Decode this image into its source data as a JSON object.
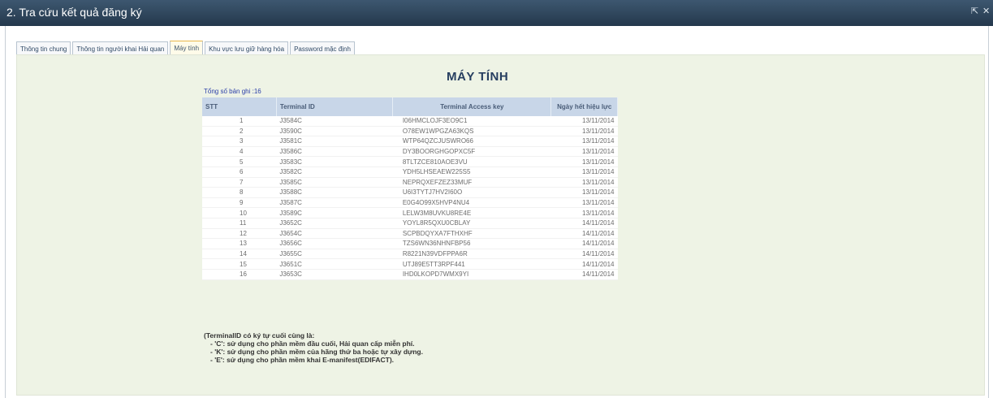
{
  "window": {
    "title": "2. Tra cứu kết quả đăng ký",
    "restore_icon": "restore-icon",
    "close_icon": "close-icon",
    "restore_glyph": "⇱",
    "close_glyph": "✕"
  },
  "tabs": [
    {
      "label": "Thông tin chung",
      "active": false
    },
    {
      "label": "Thông tin người khai Hải quan",
      "active": false
    },
    {
      "label": "Máy tính",
      "active": true
    },
    {
      "label": "Khu vực lưu giữ hàng hóa",
      "active": false
    },
    {
      "label": "Password mặc định",
      "active": false
    }
  ],
  "main": {
    "heading": "MÁY TÍNH",
    "record_count": "Tổng số bản ghi :16"
  },
  "table": {
    "headers": [
      "STT",
      "Terminal ID",
      "Terminal Access key",
      "Ngày hết hiệu lực"
    ],
    "rows": [
      [
        "1",
        "J3584C",
        "I06HMCLOJF3EO9C1",
        "13/11/2014"
      ],
      [
        "2",
        "J3590C",
        "O78EW1WPGZA63KQS",
        "13/11/2014"
      ],
      [
        "3",
        "J3581C",
        "WTP64QZCJUSWRO66",
        "13/11/2014"
      ],
      [
        "4",
        "J3586C",
        "DY3BOORGHGOPXC5F",
        "13/11/2014"
      ],
      [
        "5",
        "J3583C",
        "8TLTZCE810AOE3VU",
        "13/11/2014"
      ],
      [
        "6",
        "J3582C",
        "YDH5LHSEAEW225S5",
        "13/11/2014"
      ],
      [
        "7",
        "J3585C",
        "NEPRQXEFZEZ33MUF",
        "13/11/2014"
      ],
      [
        "8",
        "J3588C",
        "U6I3TYTJ7HV2I60O",
        "13/11/2014"
      ],
      [
        "9",
        "J3587C",
        "E0G4O99X5HVP4NU4",
        "13/11/2014"
      ],
      [
        "10",
        "J3589C",
        "LELW3M8UVKU8RE4E",
        "13/11/2014"
      ],
      [
        "11",
        "J3652C",
        "YOYL8R5QXU0CBLAY",
        "14/11/2014"
      ],
      [
        "12",
        "J3654C",
        "SCPBDQYXA7FTHXHF",
        "14/11/2014"
      ],
      [
        "13",
        "J3656C",
        "TZS6WN36NHNFBP56",
        "14/11/2014"
      ],
      [
        "14",
        "J3655C",
        "R8221N39VDFPPA6R",
        "14/11/2014"
      ],
      [
        "15",
        "J3651C",
        "UTJ89E5TT3RPF441",
        "14/11/2014"
      ],
      [
        "16",
        "J3653C",
        "IHD0LKOPD7WMX9YI",
        "14/11/2014"
      ]
    ]
  },
  "notes": [
    "(TerminalID có ký tự cuối cùng là:",
    "- 'C': sử dụng cho phần mềm đầu cuối, Hải quan cấp miễn phí.",
    "- 'K': sử dụng cho phần mềm của hãng thứ ba hoặc tự xây dựng.",
    "- 'E': sử dụng cho phần mềm khai E-manifest(EDIFACT)."
  ]
}
